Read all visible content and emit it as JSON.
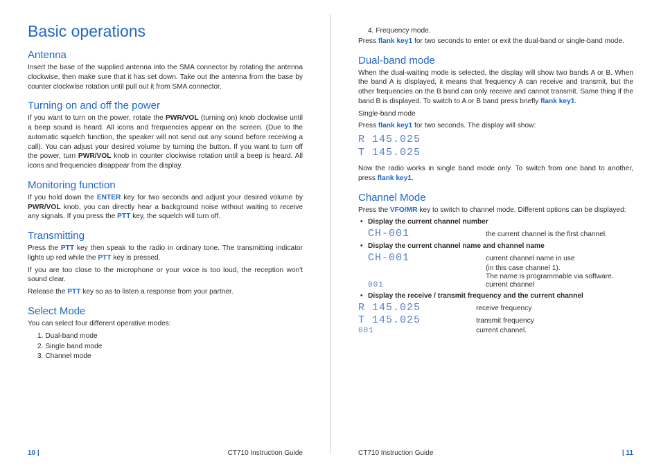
{
  "left": {
    "h1": "Basic operations",
    "antenna": {
      "title": "Antenna",
      "p1": "Insert the base of the supplied antenna into the SMA connector by rotating the antenna clockwise, then make sure that it has set down. Take out the antenna from the base by counter clockwise rotation until pull out it from SMA connector."
    },
    "power": {
      "title": "Turning on and off the power",
      "p1a": "If you want to turn on the power, rotate the ",
      "p1b": "PWR/VOL",
      "p1c": " (turning on) knob clockwise until a beep sound is heard. All icons and frequencies appear on the screen. (Due to the automatic squelch function, the speaker will not send out any sound before receiving a call). You can adjust your desired volume by turning the button. If you want to turn off the power, turn ",
      "p1d": "PWR/VOL",
      "p1e": " knob in counter clockwise rotation until a beep is heard. All icons and frequencies disappear from the display."
    },
    "monitor": {
      "title": "Monitoring function",
      "p1a": "If you hold down the ",
      "p1b": "ENTER",
      "p1c": " key for two seconds and adjust your desired volume by ",
      "p1d": "PWR/VOL",
      "p1e": " knob, you can directly hear a background noise without waiting to receive any signals. If you press the ",
      "p1f": "PTT",
      "p1g": " key, the squelch will turn off."
    },
    "transmit": {
      "title": "Transmitting",
      "p1a": "Press the ",
      "p1b": "PTT",
      "p1c": " key then speak to the radio in ordinary tone. The transmitting indicator lights up red while the ",
      "p1d": "PTT",
      "p1e": " key is pressed.",
      "p2": "If you are too close to the microphone or your voice is too loud, the reception won't sound clear.",
      "p3a": "Release the ",
      "p3b": "PTT",
      "p3c": " key so as to listen a response from your partner."
    },
    "select": {
      "title": "Select Mode",
      "p1": "You can select four different operative modes:",
      "i1": "1.   Dual-band mode",
      "i2": "2.   Single band mode",
      "i3": "3.   Channel mode"
    },
    "footer": {
      "pg": "10 |",
      "guide": "CT710 Instruction Guide"
    }
  },
  "right": {
    "top": {
      "i4": "4.   Frequency mode.",
      "p1a": "Press ",
      "p1b": "flank key1",
      "p1c": " for two seconds to enter or exit the dual-band or single-band mode."
    },
    "dual": {
      "title": "Dual-band mode",
      "p1a": "When the dual-waiting mode is selected, the display will show two bands A or B. When the band A is displayed, it means that frequency A can receive and transmit, but the other frequencies on the B band can only receive and cannot transmit. Same thing if the band B is displayed. To switch to A or B band press briefly ",
      "p1b": "flank key1",
      "p1c": ".",
      "p2": "Single-band mode",
      "p3a": "Press ",
      "p3b": "flank key1",
      "p3c": " for two seconds. The display will show:",
      "lcd1": "R 145.025",
      "lcd2": "T 145.025",
      "p4a": "Now the radio works in single band mode only. To switch from one band to another, press ",
      "p4b": "flank key1",
      "p4c": "."
    },
    "channel": {
      "title": "Channel Mode",
      "p1a": "Press the ",
      "p1b": "VFO/MR",
      "p1c": " key to switch to channel mode. Different options can be displayed:",
      "b1": "Display the current channel number",
      "r1_lcd": "CH-001",
      "r1_desc": "the current channel is the first channel.",
      "b2": "Display the current channel name and channel name",
      "r2_lcd": "CH-001",
      "r2_desc": "current channel name in use",
      "r2_desc2": "(in this case channel 1).",
      "r2_desc3": "The name is programmable via software.",
      "r3_lcd": "001",
      "r3_desc": "current channel",
      "b3": "Display the receive / transmit frequency and the current channel",
      "r4_lcd": "R 145.025",
      "r4_desc": "receive frequency",
      "r5_lcd": "T 145.025",
      "r5_desc": "transmit frequency",
      "r6_lcd": "001",
      "r6_desc": "current channel."
    },
    "footer": {
      "guide": "CT710 Instruction Guide",
      "pg": "| 11"
    }
  }
}
